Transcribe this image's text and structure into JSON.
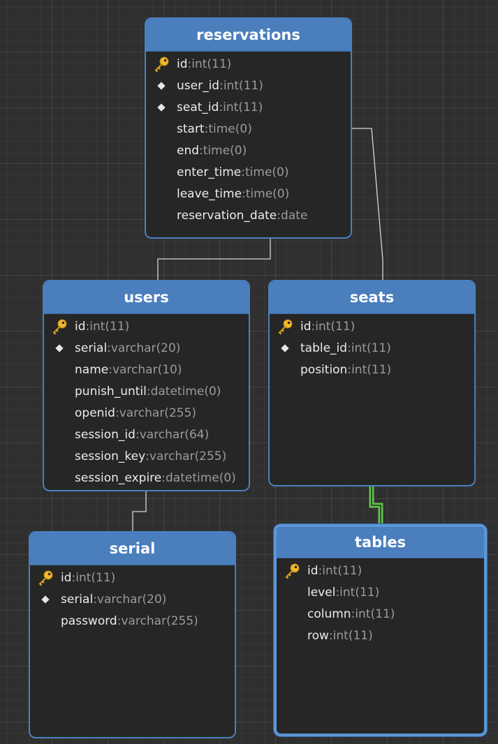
{
  "entities": [
    {
      "id": "reservations",
      "title": "reservations",
      "fields": [
        {
          "name": "id",
          "type": "int(11)",
          "icon": "key-icon"
        },
        {
          "name": "user_id",
          "type": "int(11)",
          "icon": "diamond-icon"
        },
        {
          "name": "seat_id",
          "type": "int(11)",
          "icon": "diamond-icon"
        },
        {
          "name": "start",
          "type": "time(0)",
          "icon": ""
        },
        {
          "name": "end",
          "type": "time(0)",
          "icon": ""
        },
        {
          "name": "enter_time",
          "type": "time(0)",
          "icon": ""
        },
        {
          "name": "leave_time",
          "type": "time(0)",
          "icon": ""
        },
        {
          "name": "reservation_date",
          "type": "date",
          "icon": ""
        }
      ]
    },
    {
      "id": "users",
      "title": "users",
      "fields": [
        {
          "name": "id",
          "type": "int(11)",
          "icon": "key-icon"
        },
        {
          "name": "serial",
          "type": "varchar(20)",
          "icon": "diamond-icon"
        },
        {
          "name": "name",
          "type": "varchar(10)",
          "icon": ""
        },
        {
          "name": "punish_until",
          "type": "datetime(0)",
          "icon": ""
        },
        {
          "name": "openid",
          "type": "varchar(255)",
          "icon": ""
        },
        {
          "name": "session_id",
          "type": "varchar(64)",
          "icon": ""
        },
        {
          "name": "session_key",
          "type": "varchar(255)",
          "icon": ""
        },
        {
          "name": "session_expire",
          "type": "datetime(0)",
          "icon": ""
        }
      ]
    },
    {
      "id": "seats",
      "title": "seats",
      "fields": [
        {
          "name": "id",
          "type": "int(11)",
          "icon": "key-icon"
        },
        {
          "name": "table_id",
          "type": "int(11)",
          "icon": "diamond-icon"
        },
        {
          "name": "position",
          "type": "int(11)",
          "icon": ""
        }
      ]
    },
    {
      "id": "serial",
      "title": "serial",
      "fields": [
        {
          "name": "id",
          "type": "int(11)",
          "icon": "key-icon"
        },
        {
          "name": "serial",
          "type": "varchar(20)",
          "icon": "diamond-icon"
        },
        {
          "name": "password",
          "type": "varchar(255)",
          "icon": ""
        }
      ]
    },
    {
      "id": "tables",
      "title": "tables",
      "selected": true,
      "fields": [
        {
          "name": "id",
          "type": "int(11)",
          "icon": "key-icon"
        },
        {
          "name": "level",
          "type": "int(11)",
          "icon": ""
        },
        {
          "name": "column",
          "type": "int(11)",
          "icon": ""
        },
        {
          "name": "row",
          "type": "int(11)",
          "icon": ""
        }
      ]
    }
  ],
  "relations": [
    {
      "from": "reservations",
      "to": "users",
      "highlighted": false
    },
    {
      "from": "reservations",
      "to": "seats",
      "highlighted": false
    },
    {
      "from": "users",
      "to": "serial",
      "highlighted": false
    },
    {
      "from": "seats",
      "to": "tables",
      "highlighted": true
    }
  ],
  "colors": {
    "header": "#4a7ebd",
    "border": "#4b7fbf",
    "body": "#262626",
    "field_name": "#ececec",
    "field_type": "#9b9b9b",
    "connector": "#d8d8d8",
    "connector_highlight": "#5ec44a",
    "key": "#f2b82c"
  }
}
